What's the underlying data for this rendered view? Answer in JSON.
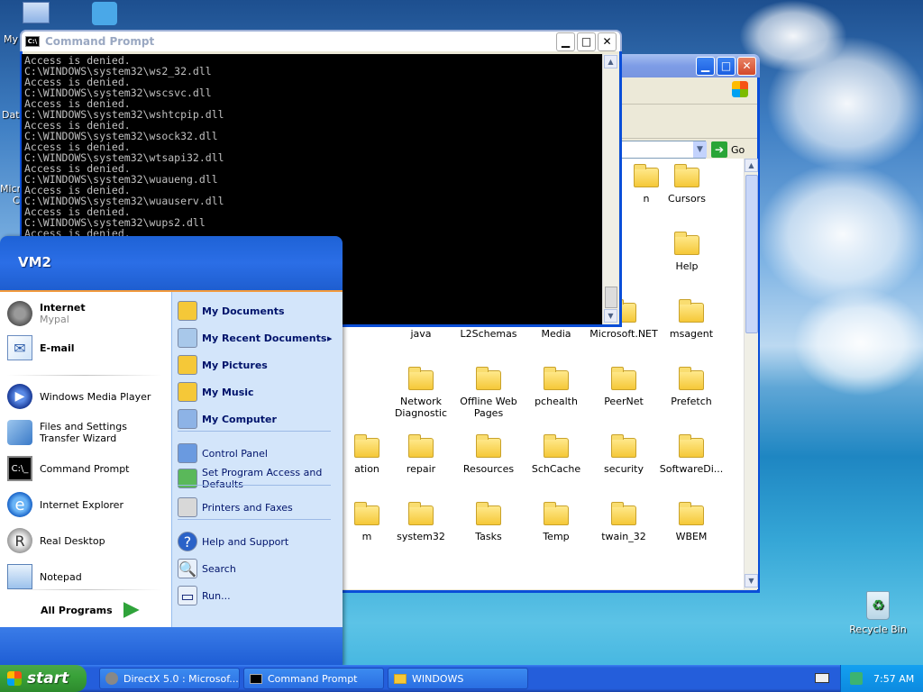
{
  "desktop": {
    "icons": [
      {
        "label": "My",
        "icon": "computer-icon"
      },
      {
        "label": "Date",
        "icon": "shortcut-icon"
      },
      {
        "label": "Micro",
        "icon": "shortcut-icon"
      },
      {
        "label": "C",
        "icon": "shortcut-icon"
      },
      {
        "label": "Recycle Bin",
        "icon": "recycle-bin-icon"
      }
    ]
  },
  "cmd": {
    "title": "Command Prompt",
    "lines": [
      "Access is denied.",
      "C:\\WINDOWS\\system32\\ws2_32.dll",
      "Access is denied.",
      "C:\\WINDOWS\\system32\\wscsvc.dll",
      "Access is denied.",
      "C:\\WINDOWS\\system32\\wshtcpip.dll",
      "Access is denied.",
      "C:\\WINDOWS\\system32\\wsock32.dll",
      "Access is denied.",
      "C:\\WINDOWS\\system32\\wtsapi32.dll",
      "Access is denied.",
      "C:\\WINDOWS\\system32\\wuaueng.dll",
      "Access is denied.",
      "C:\\WINDOWS\\system32\\wuauserv.dll",
      "Access is denied.",
      "C:\\WINDOWS\\system32\\wups2.dll",
      "Access is denied."
    ]
  },
  "explorer": {
    "go_label": "Go",
    "folders": [
      {
        "label": "n"
      },
      {
        "label": "Cursors"
      },
      {
        "label": "Help"
      },
      {
        "label": "java"
      },
      {
        "label": "L2Schemas"
      },
      {
        "label": "Media"
      },
      {
        "label": "Microsoft.NET"
      },
      {
        "label": "msagent"
      },
      {
        "label": "Network Diagnostic"
      },
      {
        "label": "Offline Web Pages"
      },
      {
        "label": "pchealth"
      },
      {
        "label": "PeerNet"
      },
      {
        "label": "Prefetch"
      },
      {
        "label": "ation"
      },
      {
        "label": "repair"
      },
      {
        "label": "Resources"
      },
      {
        "label": "SchCache"
      },
      {
        "label": "security"
      },
      {
        "label": "SoftwareDi..."
      },
      {
        "label": "m"
      },
      {
        "label": "system32"
      },
      {
        "label": "Tasks"
      },
      {
        "label": "Temp"
      },
      {
        "label": "twain_32"
      },
      {
        "label": "WBEM"
      }
    ]
  },
  "start_menu": {
    "user": "VM2",
    "pinned": [
      {
        "label": "Internet",
        "sub": "Mypal",
        "icon": "raccoon-browser-icon"
      },
      {
        "label": "E-mail",
        "sub": "",
        "icon": "email-icon"
      }
    ],
    "recent": [
      {
        "label": "Windows Media Player",
        "icon": "media-player-icon"
      },
      {
        "label": "Files and Settings Transfer Wizard",
        "icon": "transfer-wizard-icon"
      },
      {
        "label": "Command Prompt",
        "icon": "cmd-icon"
      },
      {
        "label": "Internet Explorer",
        "icon": "ie-icon"
      },
      {
        "label": "Real Desktop",
        "icon": "real-desktop-icon"
      },
      {
        "label": "Notepad",
        "icon": "notepad-icon"
      }
    ],
    "all_programs": "All Programs",
    "right": [
      {
        "label": "My Documents",
        "bold": true,
        "icon": "folder-docs-icon"
      },
      {
        "label": "My Recent Documents",
        "bold": true,
        "icon": "recent-docs-icon"
      },
      {
        "label": "My Pictures",
        "bold": true,
        "icon": "folder-pictures-icon"
      },
      {
        "label": "My Music",
        "bold": true,
        "icon": "folder-music-icon"
      },
      {
        "label": "My Computer",
        "bold": true,
        "icon": "computer-icon"
      },
      {
        "label": "Control Panel",
        "bold": false,
        "icon": "control-panel-icon"
      },
      {
        "label": "Set Program Access and Defaults",
        "bold": false,
        "icon": "program-access-icon"
      },
      {
        "label": "Printers and Faxes",
        "bold": false,
        "icon": "printer-icon"
      },
      {
        "label": "Help and Support",
        "bold": false,
        "icon": "help-icon"
      },
      {
        "label": "Search",
        "bold": false,
        "icon": "search-icon"
      },
      {
        "label": "Run...",
        "bold": false,
        "icon": "run-icon"
      }
    ]
  },
  "taskbar": {
    "start_label": "start",
    "buttons": [
      {
        "label": "DirectX 5.0 : Microsof...",
        "icon": "raccoon-browser-icon"
      },
      {
        "label": "Command Prompt",
        "icon": "cmd-icon"
      },
      {
        "label": "WINDOWS",
        "icon": "folder-icon"
      }
    ],
    "clock": "7:57 AM"
  },
  "colors": {
    "xp_blue": "#0a54d8",
    "start_green": "#39a239",
    "menu_right": "#d3e5fa"
  }
}
